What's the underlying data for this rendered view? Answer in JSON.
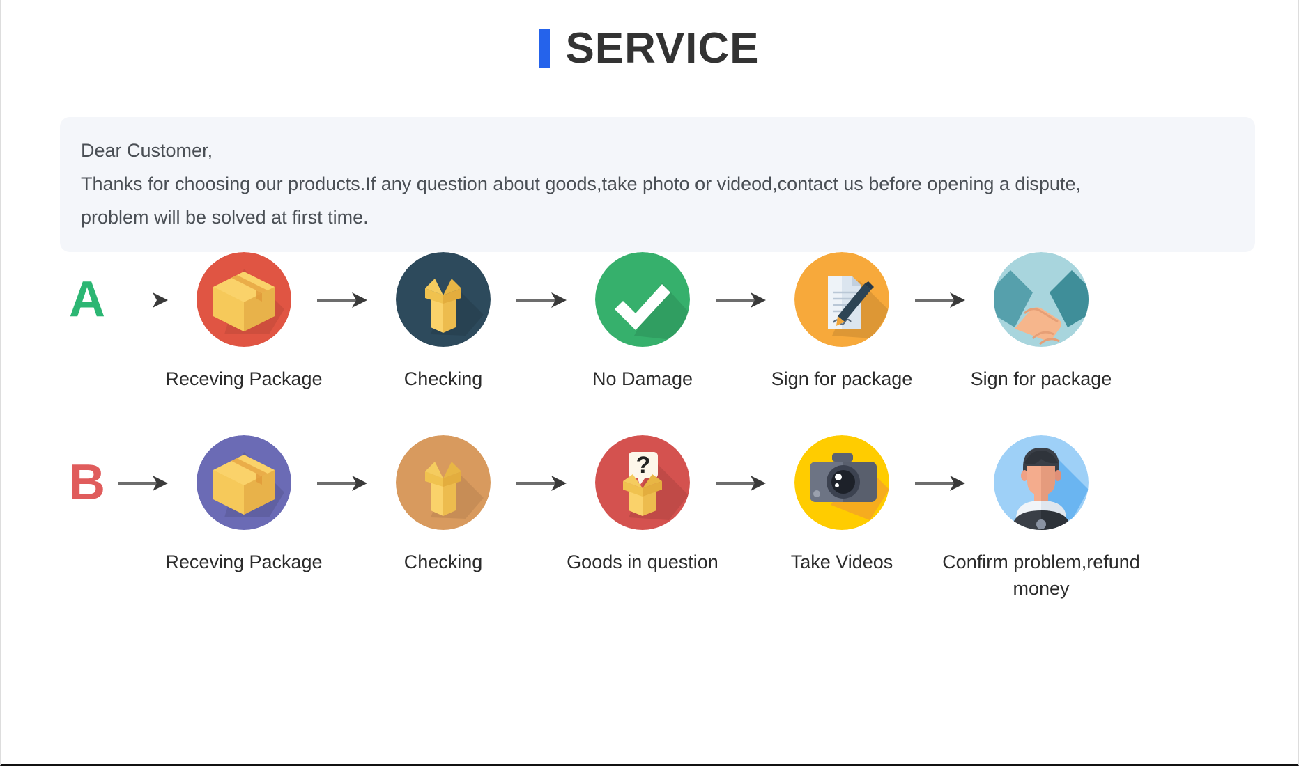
{
  "header": {
    "accent_color": "#2563eb",
    "title": "SERVICE"
  },
  "notice": {
    "lines": [
      "Dear Customer,",
      "Thanks for choosing our products.If any question about goods,take photo or videod,contact us before opening a dispute,",
      "problem will be solved at first time."
    ],
    "background_color": "#f4f6fa",
    "text_color": "#4a4f55"
  },
  "flows": [
    {
      "badge": "A",
      "badge_color": "#2cb673",
      "steps": [
        {
          "label": "Receving Package",
          "icon": "closed-box-icon",
          "circle_color": "#e05543"
        },
        {
          "label": "Checking",
          "icon": "open-box-icon",
          "circle_color": "#2d4a5c"
        },
        {
          "label": "No Damage",
          "icon": "checkmark-icon",
          "circle_color": "#36b06c"
        },
        {
          "label": "Sign for package",
          "icon": "document-pen-icon",
          "circle_color": "#f7a93b"
        },
        {
          "label": "Sign for package",
          "icon": "handshake-icon",
          "circle_color": "#a8d5dd"
        }
      ]
    },
    {
      "badge": "B",
      "badge_color": "#e05c5c",
      "steps": [
        {
          "label": "Receving Package",
          "icon": "closed-box-icon",
          "circle_color": "#6b6bb5"
        },
        {
          "label": "Checking",
          "icon": "open-box-icon",
          "circle_color": "#d89a5e"
        },
        {
          "label": "Goods in question",
          "icon": "question-box-icon",
          "circle_color": "#d4524f"
        },
        {
          "label": "Take Videos",
          "icon": "camera-icon",
          "circle_color": "#ffcc00"
        },
        {
          "label": "Confirm problem,refund money",
          "icon": "support-agent-icon",
          "circle_color": "#9ed0f7"
        }
      ]
    }
  ],
  "arrow": {
    "name": "arrow-right-icon",
    "color": "#444444"
  }
}
